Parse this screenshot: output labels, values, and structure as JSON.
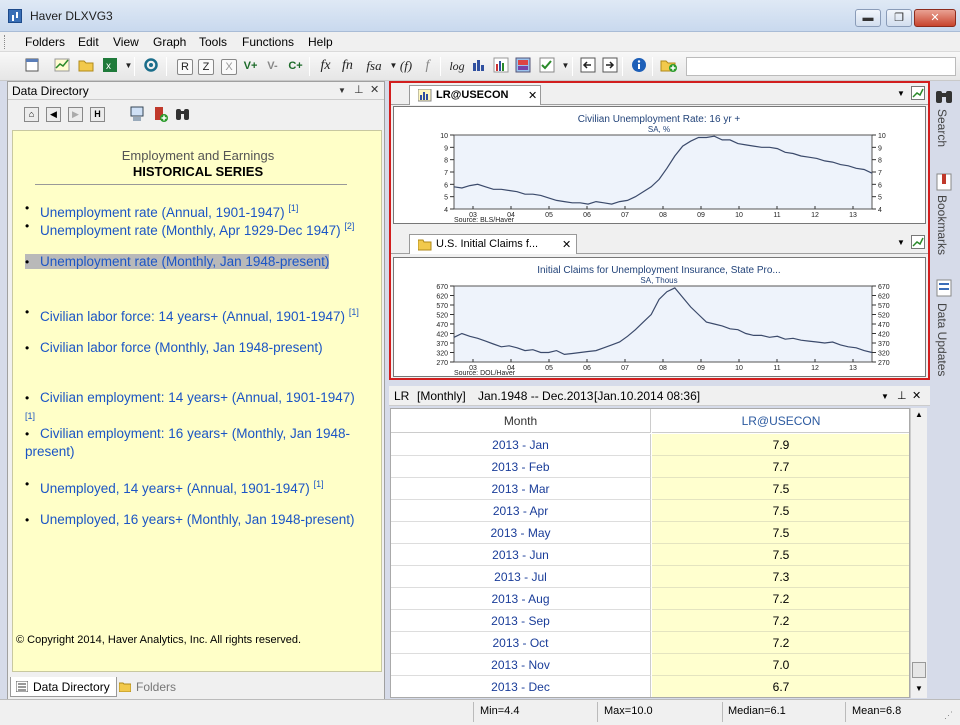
{
  "window": {
    "title": "Haver DLXVG3",
    "minimize": "▬",
    "maximize": "❐",
    "close": "✕"
  },
  "menu": [
    "Folders",
    "Edit",
    "View",
    "Graph",
    "Tools",
    "Functions",
    "Help"
  ],
  "toolbar": {
    "r": "R",
    "z": "Z",
    "x": "X",
    "vplus": "V+",
    "vminus": "V-",
    "cplus": "C+",
    "fx": "fx",
    "fn": "fn",
    "fsa": "fsa",
    "f_paren": "(f)",
    "f_small": "f",
    "log": "log"
  },
  "data_directory": {
    "title": "Data Directory",
    "section": "Employment and Earnings",
    "series_title": "HISTORICAL SERIES",
    "links": [
      {
        "text": "Unemployment rate (Annual, 1901-1947)",
        "note": "[1]"
      },
      {
        "text": "Unemployment rate (Monthly, Apr 1929-Dec 1947)",
        "note": "[2]"
      },
      {
        "text": "Unemployment rate (Monthly, Jan 1948-present)",
        "note": ""
      },
      {
        "text": "Civilian labor force: 14 years+ (Annual, 1901-1947)",
        "note": "[1]"
      },
      {
        "text": "Civilian labor force (Monthly, Jan 1948-present)",
        "note": ""
      },
      {
        "text": "Civilian employment: 14 years+ (Annual, 1901-1947)",
        "note": "[1]"
      },
      {
        "text": "Civilian employment: 16 years+ (Monthly, Jan 1948-present)",
        "note": ""
      },
      {
        "text": "Unemployed, 14 years+ (Annual, 1901-1947)",
        "note": "[1]"
      },
      {
        "text": "Unemployed, 16 years+ (Monthly, Jan 1948-present)",
        "note": ""
      }
    ],
    "copyright": "© Copyright 2014, Haver Analytics, Inc. All rights reserved.",
    "tabs": [
      "Data Directory",
      "Folders"
    ]
  },
  "charts": [
    {
      "tab": "LR@USECON",
      "title": "Civilian Unemployment Rate: 16 yr +",
      "subtitle": "SA, %",
      "source": "Source: BLS/Haver",
      "ylim": [
        4,
        10
      ],
      "yticks": [
        4,
        5,
        6,
        7,
        8,
        9,
        10
      ],
      "xticks": [
        "03",
        "04",
        "05",
        "06",
        "07",
        "08",
        "09",
        "10",
        "11",
        "12",
        "13"
      ],
      "values": [
        5.8,
        5.7,
        5.9,
        6.0,
        5.8,
        5.6,
        5.6,
        5.5,
        5.4,
        5.2,
        5.2,
        5.1,
        4.9,
        4.7,
        4.6,
        4.5,
        4.5,
        4.4,
        4.6,
        4.5,
        4.4,
        4.6,
        4.7,
        5.0,
        5.4,
        5.8,
        6.4,
        7.3,
        8.3,
        9.1,
        9.5,
        9.8,
        9.8,
        9.9,
        9.6,
        9.6,
        9.3,
        9.2,
        9.1,
        9.0,
        9.0,
        8.9,
        8.6,
        8.5,
        8.3,
        8.2,
        8.1,
        7.9,
        7.8,
        7.6,
        7.5,
        7.3,
        7.2,
        6.9
      ]
    },
    {
      "tab": "U.S. Initial Claims f...",
      "title": "Initial Claims for Unemployment Insurance, State Pro...",
      "subtitle": "SA, Thous",
      "source": "Source: DOL/Haver",
      "ylim": [
        270,
        670
      ],
      "yticks": [
        270,
        320,
        370,
        420,
        470,
        520,
        570,
        620,
        670
      ],
      "xticks": [
        "03",
        "04",
        "05",
        "06",
        "07",
        "08",
        "09",
        "10",
        "11",
        "12",
        "13"
      ],
      "values": [
        400,
        420,
        405,
        395,
        380,
        365,
        350,
        355,
        345,
        330,
        335,
        320,
        320,
        330,
        310,
        315,
        320,
        325,
        330,
        345,
        360,
        375,
        405,
        440,
        480,
        520,
        600,
        640,
        660,
        610,
        560,
        520,
        480,
        470,
        460,
        445,
        440,
        420,
        410,
        410,
        400,
        405,
        390,
        395,
        385,
        380,
        375,
        370,
        375,
        360,
        350,
        345,
        330,
        320
      ]
    }
  ],
  "table": {
    "header": {
      "series": "LR",
      "freq": "[Monthly]",
      "range": "Jan.1948 -- Dec.2013",
      "stamp": "[Jan.10.2014 08:36]"
    },
    "col_month": "Month",
    "col_value": "LR@USECON",
    "rows": [
      [
        "2013 - Jan",
        "7.9"
      ],
      [
        "2013 - Feb",
        "7.7"
      ],
      [
        "2013 - Mar",
        "7.5"
      ],
      [
        "2013 - Apr",
        "7.5"
      ],
      [
        "2013 - May",
        "7.5"
      ],
      [
        "2013 - Jun",
        "7.5"
      ],
      [
        "2013 - Jul",
        "7.3"
      ],
      [
        "2013 - Aug",
        "7.2"
      ],
      [
        "2013 - Sep",
        "7.2"
      ],
      [
        "2013 - Oct",
        "7.2"
      ],
      [
        "2013 - Nov",
        "7.0"
      ],
      [
        "2013 - Dec",
        "6.7"
      ]
    ]
  },
  "sidebar": [
    "Search",
    "Bookmarks",
    "Data Updates"
  ],
  "status": {
    "min": "Min=4.4",
    "max": "Max=10.0",
    "median": "Median=6.1",
    "mean": "Mean=6.8"
  },
  "colors": {
    "accent_red": "#d21e1e",
    "link_blue": "#1b55c5",
    "pane_yellow": "#ffffc8",
    "chart_line": "#3b4a6b",
    "chart_bg": "#eef3fb"
  }
}
